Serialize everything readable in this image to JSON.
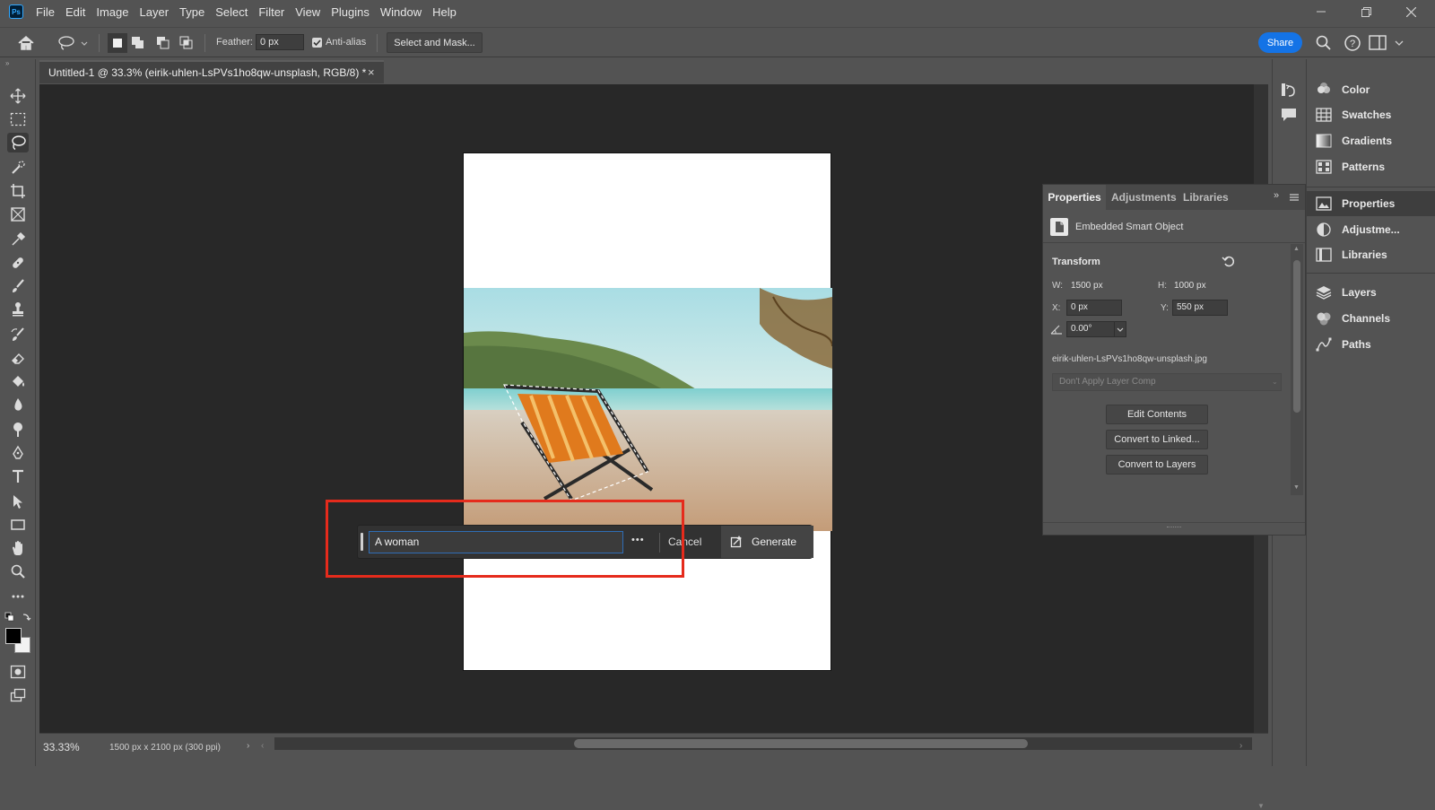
{
  "menu": [
    "File",
    "Edit",
    "Image",
    "Layer",
    "Type",
    "Select",
    "Filter",
    "View",
    "Plugins",
    "Window",
    "Help"
  ],
  "logo_text": "Ps",
  "options": {
    "feather_label": "Feather:",
    "feather_value": "0 px",
    "antialias_label": "Anti-alias",
    "select_mask_label": "Select and Mask...",
    "share_label": "Share"
  },
  "document_tab": "Untitled-1 @ 33.3% (eirik-uhlen-LsPVs1ho8qw-unsplash, RGB/8) *",
  "status": {
    "zoom": "33.33%",
    "dimensions": "1500 px x 2100 px (300 ppi)"
  },
  "generative": {
    "prompt_value": "A woman",
    "more_label": "•••",
    "cancel_label": "Cancel",
    "generate_label": "Generate"
  },
  "right_panel": {
    "items": [
      "Color",
      "Swatches",
      "Gradients",
      "Patterns",
      "Properties",
      "Adjustme...",
      "Libraries",
      "Layers",
      "Channels",
      "Paths"
    ]
  },
  "properties": {
    "tabs": [
      "Properties",
      "Adjustments",
      "Libraries"
    ],
    "object_type": "Embedded Smart Object",
    "transform_label": "Transform",
    "w_label": "W:",
    "w_value": "1500 px",
    "h_label": "H:",
    "h_value": "1000 px",
    "x_label": "X:",
    "x_value": "0 px",
    "y_label": "Y:",
    "y_value": "550 px",
    "angle_value": "0.00°",
    "filename": "eirik-uhlen-LsPVs1ho8qw-unsplash.jpg",
    "layer_comp": "Don't Apply Layer Comp",
    "buttons": [
      "Edit Contents",
      "Convert to Linked...",
      "Convert to Layers"
    ]
  },
  "colors": {
    "accent": "#1473e6",
    "highlight": "#e52b1c"
  }
}
